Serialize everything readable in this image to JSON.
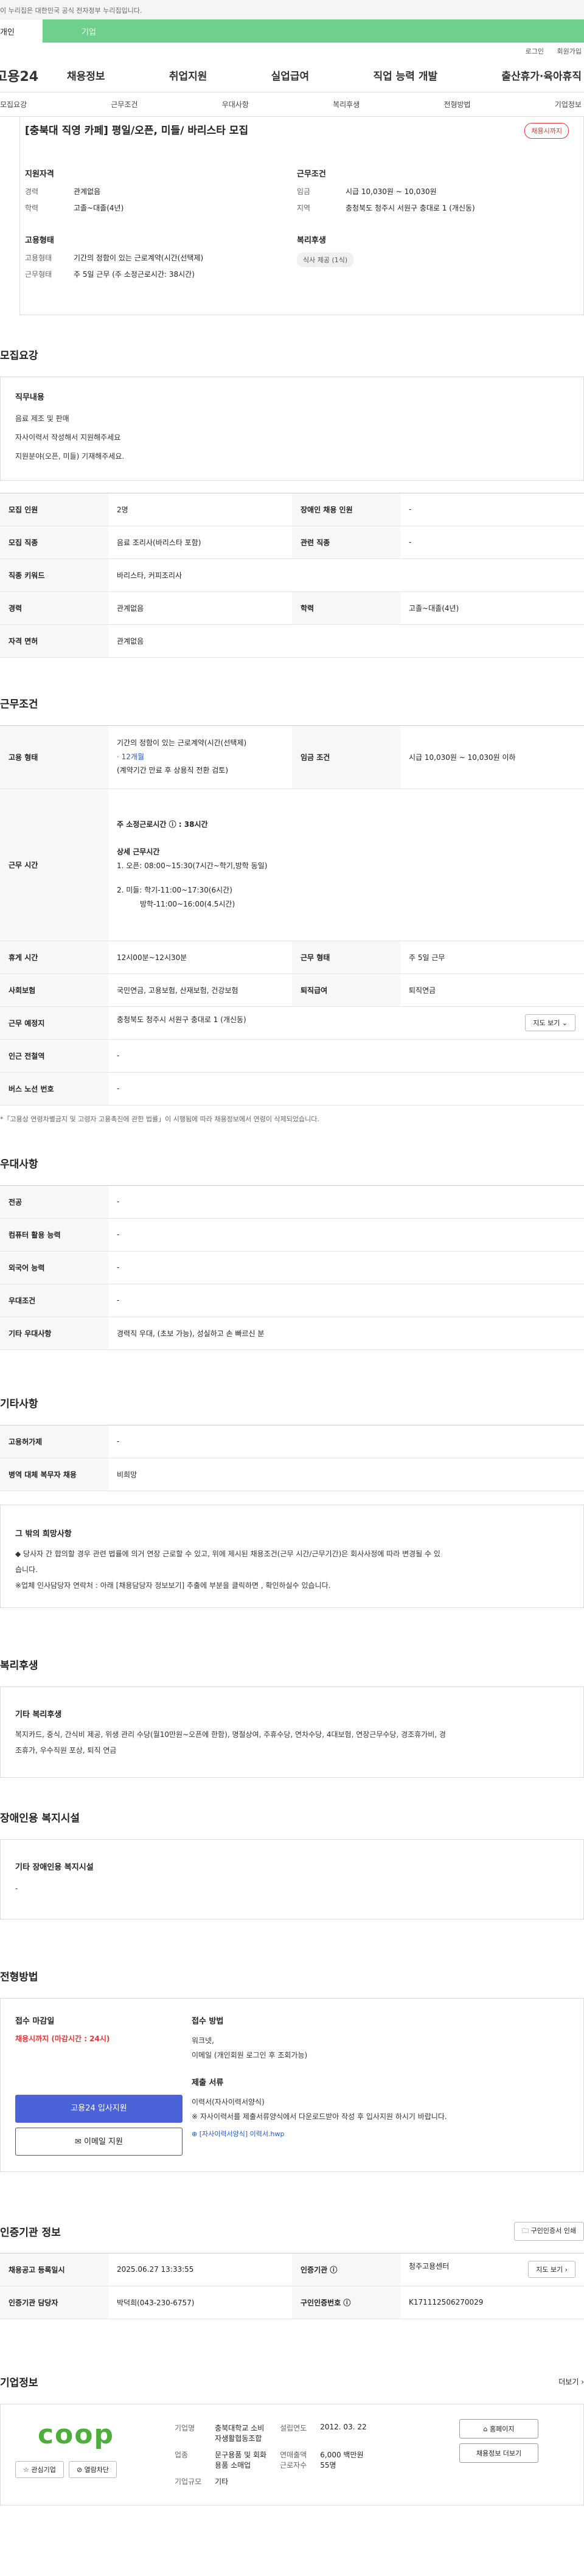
{
  "notice": "이 누리집은 대한민국 공식 전자정부 누리집입니다.",
  "mode_tabs": [
    "개인",
    "기업"
  ],
  "top_links": [
    "로그인",
    "회원가입"
  ],
  "logo": "고용24",
  "gnb": [
    "채용정보",
    "취업지원",
    "실업급여",
    "직업 능력 개발",
    "출산휴가·육아휴직"
  ],
  "subnav": [
    "모집요강",
    "근무조건",
    "우대사항",
    "복리후생",
    "전형방법",
    "기업정보"
  ],
  "job_title": "[충북대 직영 카페] 평일/오픈, 미들/ 바리스타 모집",
  "badge": "채용시까지",
  "summary": {
    "qual_head": "지원자격",
    "career_k": "경력",
    "career_v": "관계없음",
    "edu_k": "학력",
    "edu_v": "고졸~대졸(4년)",
    "emp_head": "고용형태",
    "emptype_k": "고용형태",
    "emptype_v": "기간의 정함이 있는 근로계약(시간(선택제)",
    "hours_k": "근무형태",
    "hours_v": "주 5일 근무 (주 소정근로시간: 38시간)",
    "cond_head": "근무조건",
    "wage_k": "임금",
    "wage_v": "시급 10,030원 ~ 10,030원",
    "area_k": "지역",
    "area_v": "충청북도 청주시 서원구 충대로 1 (개신동)",
    "welfare_head": "복리후생",
    "welfare_chip": "식사 제공 (1식)"
  },
  "recruit": {
    "title": "모집요강",
    "duty_head": "직무내용",
    "duty_lines": [
      "음료 제조 및 판매",
      "자사이력서 작성해서 지원해주세요",
      "지원분야(오픈, 미들) 기재해주세요."
    ],
    "rows": [
      [
        "모집 인원",
        "2명",
        "장애인 채용 인원",
        "-"
      ],
      [
        "모집 직종",
        "음료 조리사(바리스타 포함)",
        "관련 직종",
        "-"
      ],
      [
        "직종 키워드",
        "바리스타, 커피조리사",
        "",
        ""
      ],
      [
        "경력",
        "관계없음",
        "학력",
        "고졸~대졸(4년)"
      ],
      [
        "자격 면허",
        "관계없음",
        "",
        ""
      ]
    ]
  },
  "work": {
    "title": "근무조건",
    "emp_k": "고용 형태",
    "emp_v1": "기간의 정함이 있는 근로계약(시간(선택제)",
    "emp_v2": "· 12개월",
    "emp_v3": "(계약기간 만료 후 상용직 전환 검토)",
    "wage_k": "임금 조건",
    "wage_v": "시급 10,030원 ~ 10,030원 이하",
    "time_k": "근무 시간",
    "time_lines": [
      "주 소정근로시간 ⓘ : 38시간",
      "상세 근무시간",
      "1. 오픈: 08:00~15:30(7시간~학기,방학 동일)",
      "2. 미들: 학기-11:00~17:30(6시간)",
      "방학-11:00~16:00(4.5시간)"
    ],
    "break_k": "휴게 시간",
    "break_v": "12시00분~12시30분",
    "form_k": "근무 형태",
    "form_v": "주 5일 근무",
    "ins_k": "사회보험",
    "ins_v": "국민연금, 고용보험, 산재보험, 건강보험",
    "ret_k": "퇴직급여",
    "ret_v": "퇴직연금",
    "place_k": "근무 예정지",
    "place_v": "충청북도 청주시 서원구 충대로 1 (개신동)",
    "map_btn": "지도 보기 ⌄",
    "metro_k": "인근 전철역",
    "metro_v": "-",
    "bus_k": "버스 노선 번호",
    "bus_v": "-",
    "note": "*「고용상 연령차별금지 및 고령자 고용촉진에 관한 법률」이 시행됨에 따라 채용정보에서 연령이 삭제되었습니다."
  },
  "pref": {
    "title": "우대사항",
    "rows": [
      [
        "전공",
        "-"
      ],
      [
        "컴퓨터 활용 능력",
        "-"
      ],
      [
        "외국어 능력",
        "-"
      ],
      [
        "우대조건",
        "-"
      ],
      [
        "기타 우대사항",
        "경력직 우대, (초보 가능), 성실하고 손 빠르신 분"
      ]
    ]
  },
  "etc": {
    "title": "기타사항",
    "rows": [
      [
        "고용허가제",
        "-"
      ],
      [
        "병역 대체 복무자 채용",
        "비희망"
      ]
    ],
    "box_head": "그 밖의 희망사항",
    "box_lines": [
      "◆ 당사자 간 합의할 경우 관련 법률에 의거 연장 근로할 수 있고, 위에 제시된 채용조건(근무 시간/근무기간)은 회사사정에 따라 변경될 수 있",
      "습니다.",
      "※업체 인사담당자 연락처 : 아래 [채용담당자 정보보기] 추출에 부분을 클릭하면 , 확인하실수 있습니다."
    ]
  },
  "welfare": {
    "title": "복리후생",
    "head": "기타 복리후생",
    "lines": [
      "복지카드, 중식, 간식비 제공, 위생 관리 수당(월10만원~오픈에 한함), 명절상여, 주휴수당, 연차수당, 4대보험, 연장근무수당, 경조휴가비, 경",
      "조휴가, 우수직원 포상, 퇴직 연금"
    ]
  },
  "disabled": {
    "title": "장애인용 복지시설",
    "head": "기타 장애인용 복지시설",
    "value": "-"
  },
  "apply": {
    "title": "전형방법",
    "deadline_head": "접수 마감일",
    "deadline_v": "채용시까지 (마감시간 : 24시)",
    "btn_apply": "고용24 입사지원",
    "btn_email": "✉ 이메일 지원",
    "method_head": "접수 방법",
    "method_lines": [
      "워크넷,",
      "이메일 (개인회원 로그인 후 조회가능)"
    ],
    "docs_head": "제출 서류",
    "docs_lines": [
      "이력서(자사이력서양식)",
      "※ 자사이력서를 제출서류양식에서 다운로드받아 작성 후 입사지원 하시기 바랍니다."
    ],
    "file_link": "[자사이력서양식] 이력서.hwp"
  },
  "cert": {
    "title": "인증기관 정보",
    "btn": "🗀 구인인증서 인쇄",
    "rows": [
      [
        "채용공고 등록일시",
        "2025.06.27 13:33:55",
        "인증기관 ⓘ",
        "청주고용센터",
        "지도 보기 ›"
      ],
      [
        "인증기관 담당자",
        "박덕희(043-230-6757)",
        "구인인증번호 ⓘ",
        "K171112506270029",
        ""
      ]
    ]
  },
  "company": {
    "title": "기업정보",
    "more": "더보기 ›",
    "logo_text": "coop",
    "btn_like": "☆ 관심기업",
    "btn_block": "⊘ 열람차단",
    "name_k": "기업명",
    "name_v1": "충북대학교 소비",
    "name_v2": "자생활협동조합",
    "biz_k": "업종",
    "biz_v1": "문구용품 및 회화",
    "biz_v2": "용품 소매업",
    "scale_k": "기업규모",
    "scale_v": "기타",
    "year_k": "설립연도",
    "year_v": "2012. 03. 22",
    "sales_k": "연매출액",
    "sales_v": "6,000 백만원",
    "emp_k": "근로자수",
    "emp_v": "55명",
    "btn_home": "⌂ 홈페이지",
    "btn_jobs": "채용정보 더보기"
  }
}
